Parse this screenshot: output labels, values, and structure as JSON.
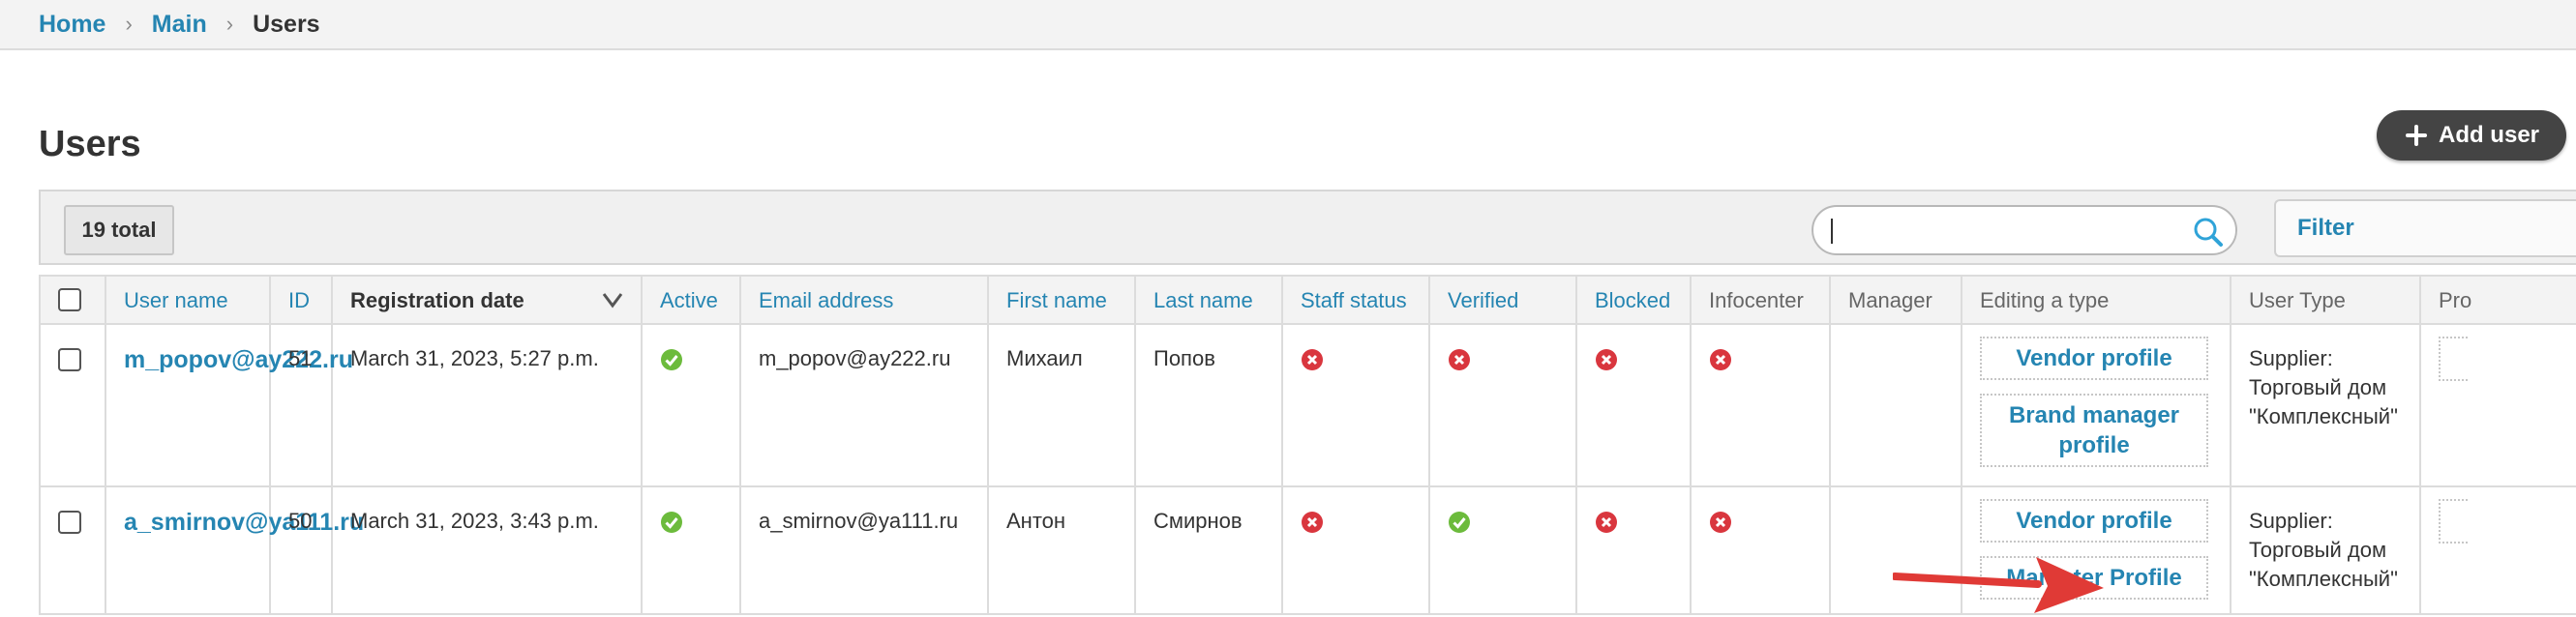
{
  "breadcrumbs": {
    "home": "Home",
    "main": "Main",
    "current": "Users",
    "separator": "›"
  },
  "page": {
    "title": "Users"
  },
  "actions": {
    "add_user": "Add user"
  },
  "toolbar": {
    "total": "19 total",
    "search_value": "",
    "filter_label": "Filter"
  },
  "table": {
    "columns": {
      "username": "User name",
      "id": "ID",
      "registration_date": "Registration date",
      "active": "Active",
      "email": "Email address",
      "first_name": "First name",
      "last_name": "Last name",
      "staff_status": "Staff status",
      "verified": "Verified",
      "blocked": "Blocked",
      "infocenter": "Infocenter",
      "manager": "Manager",
      "editing_type": "Editing a type",
      "user_type": "User Type",
      "profile_cut": "Pro"
    },
    "rows": [
      {
        "username": "m_popov@ay222.ru",
        "id": "51",
        "registration_date": "March 31, 2023, 5:27 p.m.",
        "active": true,
        "email": "m_popov@ay222.ru",
        "first_name": "Михаил",
        "last_name": "Попов",
        "staff_status": false,
        "verified": false,
        "blocked": false,
        "infocenter": false,
        "manager": "",
        "editing_buttons": [
          "Vendor profile",
          "Brand manager profile"
        ],
        "user_type_lines": [
          "Supplier:",
          "Торговый дом",
          "\"Комплексный\""
        ]
      },
      {
        "username": "a_smirnov@ya111.ru",
        "id": "50",
        "registration_date": "March 31, 2023, 3:43 p.m.",
        "active": true,
        "email": "a_smirnov@ya111.ru",
        "first_name": "Антон",
        "last_name": "Смирнов",
        "staff_status": false,
        "verified": true,
        "blocked": false,
        "infocenter": false,
        "manager": "",
        "editing_buttons": [
          "Vendor profile",
          "Marketer Profile"
        ],
        "user_type_lines": [
          "Supplier:",
          "Торговый дом",
          "\"Комплексный\""
        ]
      }
    ]
  },
  "icons": {
    "true_icon": "check-circle-icon",
    "false_icon": "x-circle-icon",
    "search": "search-icon",
    "sort": "chevron-down-icon",
    "add": "plus-icon",
    "annotation": "red-arrow-icon"
  },
  "colors": {
    "link": "#2585b2",
    "check_green": "#6cbb3c",
    "cross_red": "#d9363e",
    "arrow_red": "#e03a36",
    "button_dark": "#444444"
  }
}
